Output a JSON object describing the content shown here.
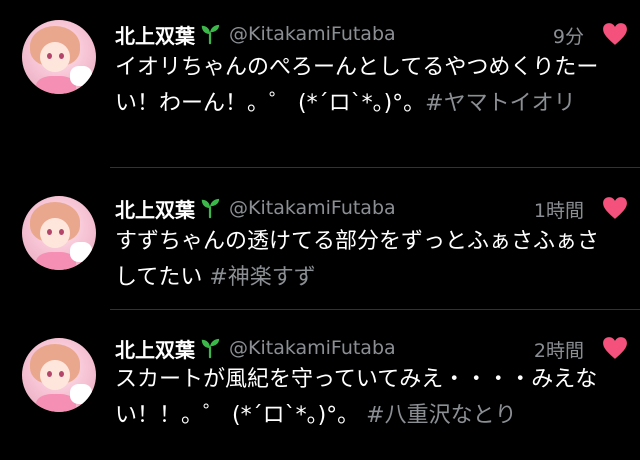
{
  "colors": {
    "background": "#000000",
    "text": "#ffffff",
    "muted": "#8b8f94",
    "heart": "#f4517d",
    "sprout": "#3cb84a"
  },
  "tweets": [
    {
      "name": "北上双葉",
      "handle": "@KitakamiFutaba",
      "time": "9分",
      "body": "イオリちゃんのぺろーんとしてるやつめくりたーい！わーん！。゜ (*´ロ`*。)°。",
      "hashtag": "#ヤマトイオリ"
    },
    {
      "name": "北上双葉",
      "handle": "@KitakamiFutaba",
      "time": "1時間",
      "body": "すずちゃんの透けてる部分をずっとふぁさふぁさしてたい",
      "hashtag": "#神楽すず"
    },
    {
      "name": "北上双葉",
      "handle": "@KitakamiFutaba",
      "time": "2時間",
      "body": "スカートが風紀を守っていてみえ・・・・みえない！！。゜ (*´ロ`*。)°。",
      "hashtag": "#八重沢なとり"
    }
  ]
}
